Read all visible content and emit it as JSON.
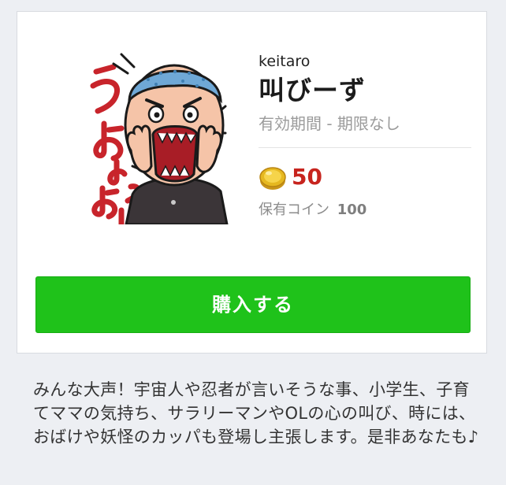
{
  "sticker": {
    "author": "keitaro",
    "title": "叫びーず",
    "validity": "有効期間 - 期限なし",
    "price": "50",
    "owned_label": "保有コイン",
    "owned_coins": "100",
    "buy_label": "購入する",
    "image_text": "うぉぉぉぉっ",
    "description": "みんな大声！宇宙人や忍者が言いそうな事、小学生、子育てママの気持ち、サラリーマンやOLの心の叫び、時には、おばけや妖怪のカッパも登場し主張します。是非あなたも♪"
  },
  "colors": {
    "background": "#edeff3",
    "buy_button": "#1fc21a",
    "price": "#c7241e",
    "coin": "#e6b820"
  },
  "icons": {
    "coin": "gold-coin-icon"
  }
}
